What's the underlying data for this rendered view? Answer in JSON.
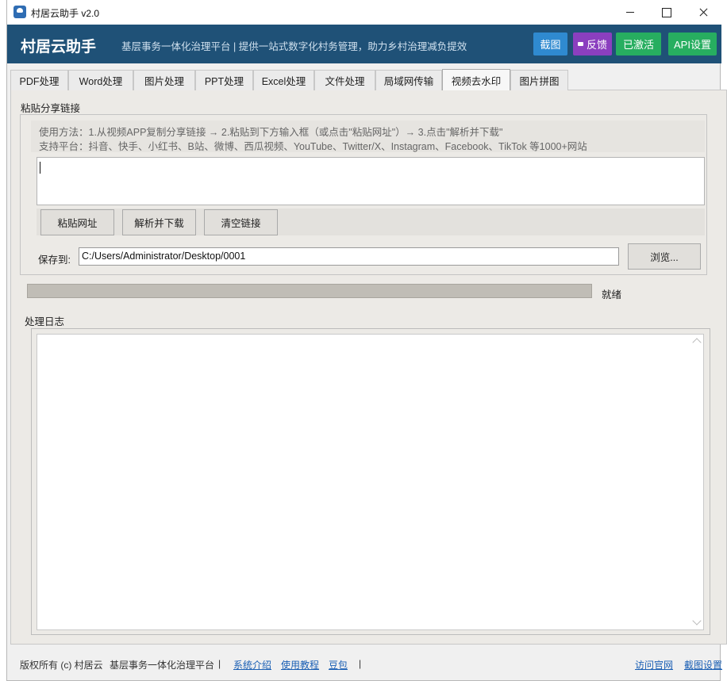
{
  "window": {
    "title": "村居云助手 v2.0"
  },
  "header": {
    "brand": "村居云助手",
    "tagline": "基层事务一体化治理平台 | 提供一站式数字化村务管理，助力乡村治理减负提效",
    "buttons": {
      "screenshot": "截图",
      "feedback": "反馈",
      "activated": "已激活",
      "api_settings": "API设置"
    },
    "colors": {
      "band": "#1f5177",
      "screenshot": "#2f8ad0",
      "feedback": "#8b3fbf",
      "activated": "#27ae60",
      "api_settings": "#27ae60"
    }
  },
  "tabs": [
    {
      "label": "PDF处理",
      "active": false
    },
    {
      "label": "Word处理",
      "active": false
    },
    {
      "label": "图片处理",
      "active": false
    },
    {
      "label": "PPT处理",
      "active": false
    },
    {
      "label": "Excel处理",
      "active": false
    },
    {
      "label": "文件处理",
      "active": false
    },
    {
      "label": "局域网传输",
      "active": false
    },
    {
      "label": "视频去水印",
      "active": true
    },
    {
      "label": "图片拼图",
      "active": false
    }
  ],
  "main": {
    "paste_section_label": "粘贴分享链接",
    "hint_usage": "使用方法：1.从视频APP复制分享链接 → 2.粘贴到下方输入框（或点击\"粘贴网址\"）→ 3.点击\"解析并下载\"",
    "hint_platforms": "支持平台：抖音、快手、小红书、B站、微博、西瓜视频、YouTube、Twitter/X、Instagram、Facebook、TikTok 等1000+网站",
    "link_input_value": "",
    "buttons": {
      "paste": "粘贴网址",
      "parse_download": "解析并下载",
      "clear": "清空链接",
      "browse": "浏览..."
    },
    "save_label": "保存到:",
    "save_path": "C:/Users/Administrator/Desktop/0001",
    "progress": 0,
    "status": "就绪",
    "log_label": "处理日志",
    "log_text": ""
  },
  "footer": {
    "copyright": "版权所有 (c) 村居云",
    "platform": "基层事务一体化治理平台",
    "separator": "|",
    "links": {
      "intro": "系统介绍",
      "tutorial": "使用教程",
      "doubao": "豆包",
      "visit": "访问官网",
      "screenshot_settings": "截图设置"
    }
  }
}
